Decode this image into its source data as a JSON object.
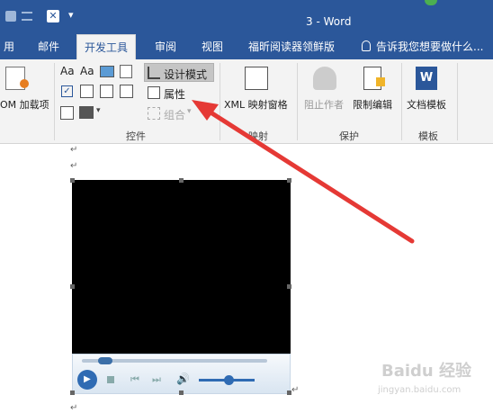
{
  "title": "3 - Word",
  "tabs": [
    {
      "label": "用"
    },
    {
      "label": "邮件"
    },
    {
      "label": "开发工具"
    },
    {
      "label": "审阅"
    },
    {
      "label": "视图"
    },
    {
      "label": "福昕阅读器领鲜版"
    }
  ],
  "tell_me": "告诉我您想要做什么...",
  "ribbon": {
    "addins_label": "OM 加载项",
    "design_mode": "设计模式",
    "properties": "属性",
    "group": "组合",
    "controls_group": "控件",
    "xml_mapping": "XML 映射窗格",
    "mapping_group": "映射",
    "block_authors": "阻止作者",
    "restrict_editing": "限制编辑",
    "protect_group": "保护",
    "document_template": "文档模板",
    "template_group": "模板"
  },
  "colors": {
    "word_blue": "#2b579a",
    "ribbon_bg": "#f3f3f3",
    "arrow_red": "#e53935"
  },
  "watermark": "Baidu 经验",
  "watermark_sub": "jingyan.baidu.com"
}
